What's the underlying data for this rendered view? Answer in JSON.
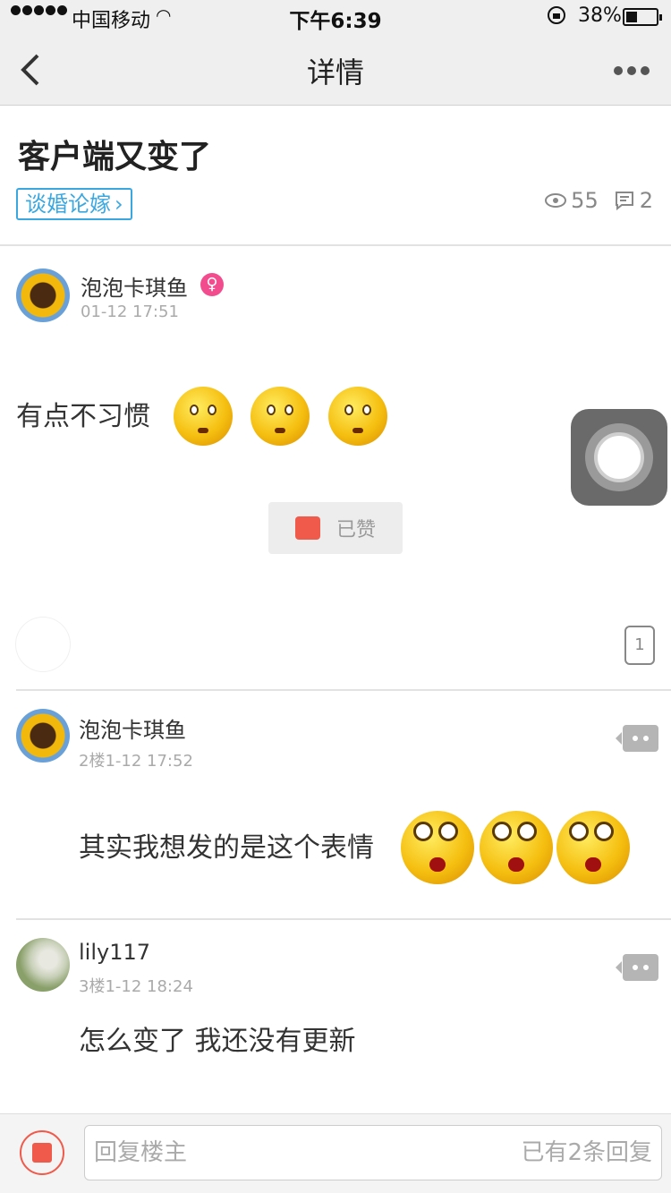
{
  "status": {
    "carrier": "中国移动",
    "time": "下午6:39",
    "battery": "38%"
  },
  "nav": {
    "title": "详情"
  },
  "post": {
    "title": "客户端又变了",
    "tag": "谈婚论嫁",
    "views": "55",
    "comments": "2",
    "author": "泡泡卡琪鱼",
    "date": "01-12 17:51",
    "body": "有点不习惯",
    "liked_label": "已赞"
  },
  "floor_badge": "1",
  "replies": [
    {
      "author": "泡泡卡琪鱼",
      "meta": "2楼1-12 17:52",
      "text": "其实我想发的是这个表情"
    },
    {
      "author": "lily117",
      "meta": "3楼1-12 18:24",
      "text": "怎么变了  我还没有更新"
    }
  ],
  "bottom": {
    "placeholder": "回复楼主",
    "reply_count": "已有2条回复"
  },
  "colors": {
    "accent": "#3aa7e0",
    "like": "#f05a4a",
    "female": "#f24c8f"
  }
}
